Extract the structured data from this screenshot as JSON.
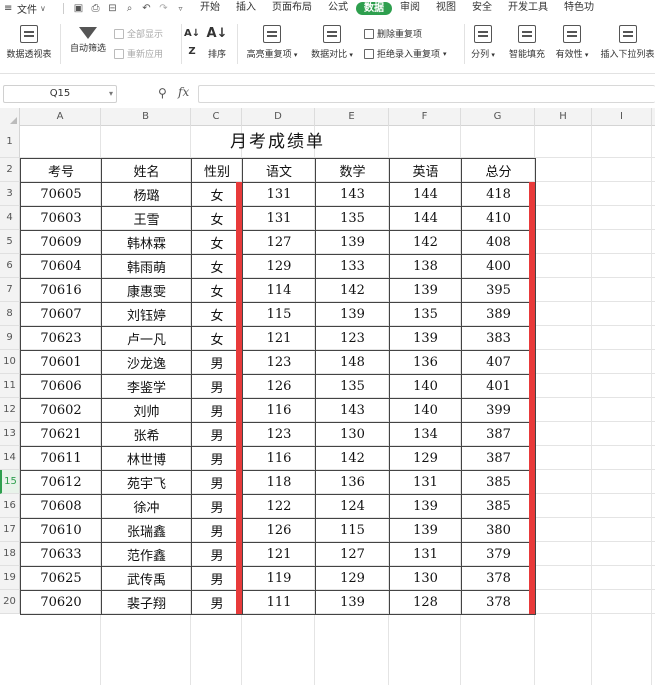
{
  "menubar": {
    "file_label": "文件",
    "tabs": [
      {
        "label": "开始"
      },
      {
        "label": "插入"
      },
      {
        "label": "页面布局"
      },
      {
        "label": "公式"
      },
      {
        "label": "数据",
        "active": true
      },
      {
        "label": "审阅"
      },
      {
        "label": "视图"
      },
      {
        "label": "安全"
      },
      {
        "label": "开发工具"
      },
      {
        "label": "特色功"
      }
    ],
    "active_color": "#2e9f4e"
  },
  "ribbon": {
    "pivot_table": "数据透视表",
    "auto_filter": "自动筛选",
    "show_all": "全部显示",
    "reapply": "重新应用",
    "sort": "排序",
    "highlight_dup": "高亮重复项",
    "data_compare": "数据对比",
    "delete_dup": "删除重复项",
    "reject_dup": "拒绝录入重复项",
    "split_col": "分列",
    "smart_fill": "智能填充",
    "validity": "有效性",
    "insert_dropdown": "插入下拉列表"
  },
  "formula_bar": {
    "cell_ref": "Q15",
    "fx": "fx",
    "value": ""
  },
  "columns": [
    "A",
    "B",
    "C",
    "D",
    "E",
    "F",
    "G",
    "H",
    "I"
  ],
  "rows": [
    "1",
    "2",
    "3",
    "4",
    "5",
    "6",
    "7",
    "8",
    "9",
    "10",
    "11",
    "12",
    "13",
    "14",
    "15",
    "16",
    "17",
    "18",
    "19",
    "20"
  ],
  "active_row": "15",
  "sheet": {
    "title": "月考成绩单",
    "headers": [
      "考号",
      "姓名",
      "性别",
      "语文",
      "数学",
      "英语",
      "总分"
    ],
    "records": [
      [
        "70605",
        "杨璐",
        "女",
        "131",
        "143",
        "144",
        "418"
      ],
      [
        "70603",
        "王雪",
        "女",
        "131",
        "135",
        "144",
        "410"
      ],
      [
        "70609",
        "韩林霖",
        "女",
        "127",
        "139",
        "142",
        "408"
      ],
      [
        "70604",
        "韩雨萌",
        "女",
        "129",
        "133",
        "138",
        "400"
      ],
      [
        "70616",
        "康惠雯",
        "女",
        "114",
        "142",
        "139",
        "395"
      ],
      [
        "70607",
        "刘钰婷",
        "女",
        "115",
        "139",
        "135",
        "389"
      ],
      [
        "70623",
        "卢一凡",
        "女",
        "121",
        "123",
        "139",
        "383"
      ],
      [
        "70601",
        "沙龙逸",
        "男",
        "123",
        "148",
        "136",
        "407"
      ],
      [
        "70606",
        "李鉴学",
        "男",
        "126",
        "135",
        "140",
        "401"
      ],
      [
        "70602",
        "刘帅",
        "男",
        "116",
        "143",
        "140",
        "399"
      ],
      [
        "70621",
        "张希",
        "男",
        "123",
        "130",
        "134",
        "387"
      ],
      [
        "70611",
        "林世博",
        "男",
        "116",
        "142",
        "129",
        "387"
      ],
      [
        "70612",
        "苑宇飞",
        "男",
        "118",
        "136",
        "131",
        "385"
      ],
      [
        "70608",
        "徐冲",
        "男",
        "122",
        "124",
        "139",
        "385"
      ],
      [
        "70610",
        "张瑞鑫",
        "男",
        "126",
        "115",
        "139",
        "380"
      ],
      [
        "70633",
        "范作鑫",
        "男",
        "121",
        "127",
        "131",
        "379"
      ],
      [
        "70625",
        "武传禹",
        "男",
        "119",
        "129",
        "130",
        "378"
      ],
      [
        "70620",
        "裴子翔",
        "男",
        "111",
        "139",
        "128",
        "378"
      ]
    ],
    "highlight_color": "#e83a3a"
  }
}
